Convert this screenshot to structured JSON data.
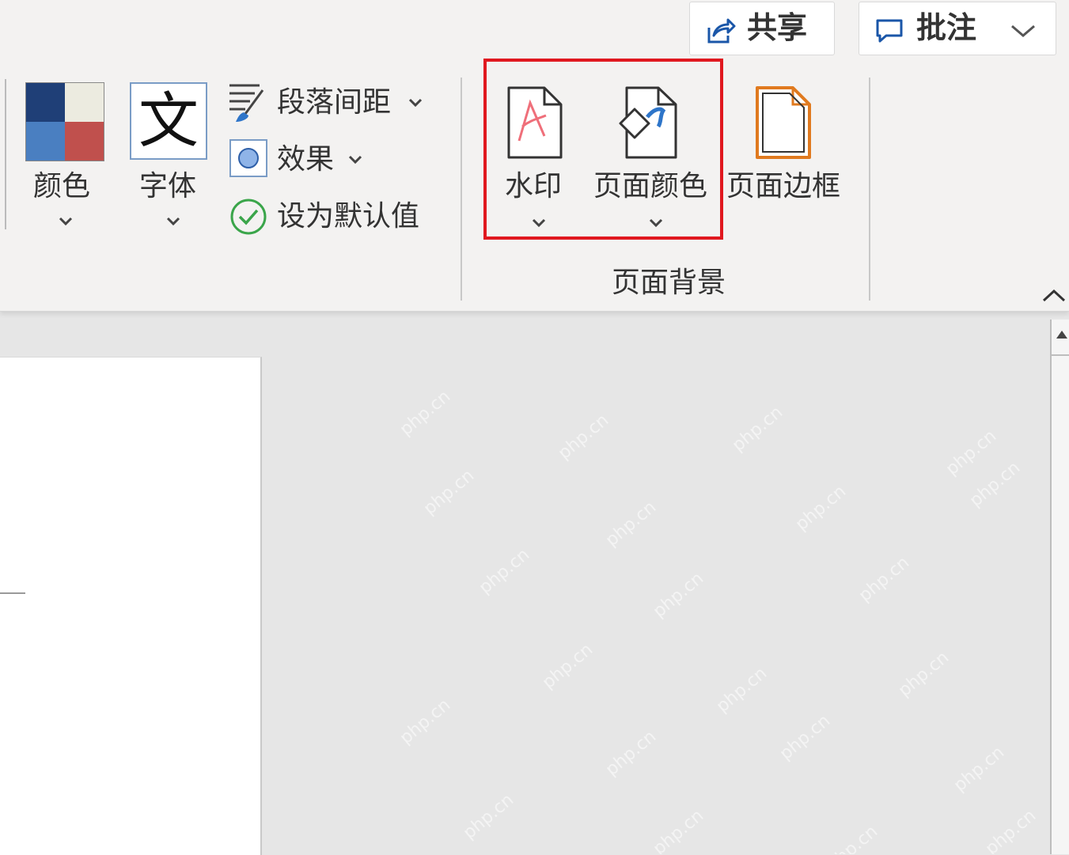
{
  "top_actions": {
    "share_label": "共享",
    "comment_label": "批注"
  },
  "design_tab": {
    "colors_label": "颜色",
    "fonts_label": "字体",
    "paragraph_spacing_label": "段落间距",
    "effects_label": "效果",
    "set_default_label": "设为默认值",
    "theme_swatch_colors": [
      "#1f3f77",
      "#ecebe0",
      "#4a7fc1",
      "#c0504d"
    ]
  },
  "page_background": {
    "group_label": "页面背景",
    "watermark_label": "水印",
    "page_color_label": "页面颜色",
    "page_borders_label": "页面边框"
  },
  "accent_colors": {
    "highlight": "#e0181f",
    "border_icon": "#e07a1f",
    "check": "#3aa54a"
  },
  "watermark_text": "php.cn"
}
